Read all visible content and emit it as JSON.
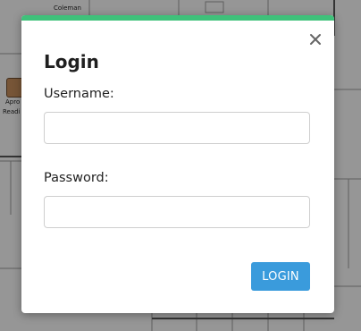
{
  "background": {
    "top_label": "Coleman",
    "person_label_line1": "Apro",
    "person_label_line2": "Readi"
  },
  "modal": {
    "title": "Login",
    "username_label": "Username:",
    "username_value": "",
    "password_label": "Password:",
    "password_value": "",
    "login_button": "LOGIN",
    "close_glyph": "×"
  },
  "colors": {
    "accent_bar": "#3fc17a",
    "login_button_bg": "#3a9bdc"
  },
  "icons": {
    "close": "close-icon",
    "avatar": "avatar"
  }
}
